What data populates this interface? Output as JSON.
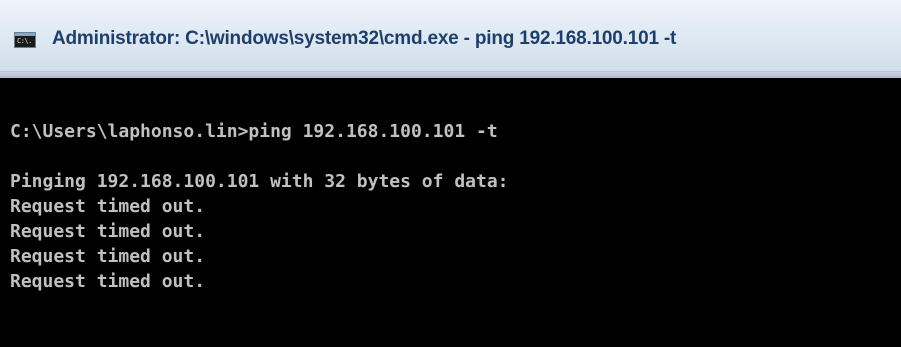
{
  "window": {
    "title": "Administrator: C:\\windows\\system32\\cmd.exe - ping  192.168.100.101 -t",
    "icon": "cmd-icon",
    "icon_glyph": "C:\\."
  },
  "console": {
    "prompt_line": "C:\\Users\\laphonso.lin>ping 192.168.100.101 -t",
    "pinging_line": "Pinging 192.168.100.101 with 32 bytes of data:",
    "responses": [
      "Request timed out.",
      "Request timed out.",
      "Request timed out.",
      "Request timed out."
    ]
  },
  "colors": {
    "console_background": "#000000",
    "console_text": "#c0c0c0",
    "title_text": "#1f3f6b"
  }
}
